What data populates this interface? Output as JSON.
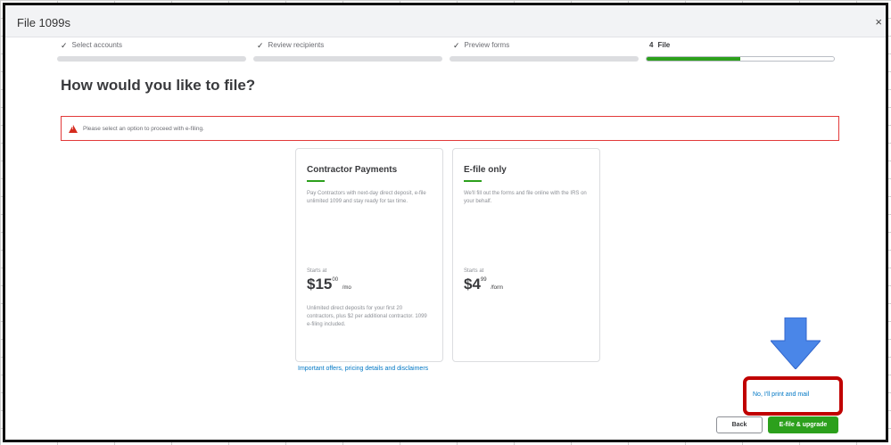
{
  "window": {
    "title": "File 1099s",
    "close_glyph": "×"
  },
  "stepper": {
    "steps": [
      {
        "label": "Select accounts",
        "prefix": "✓",
        "progress": 0
      },
      {
        "label": "Review recipients",
        "prefix": "✓",
        "progress": 0
      },
      {
        "label": "Preview forms",
        "prefix": "✓",
        "progress": 0
      },
      {
        "label": "File",
        "prefix": "4",
        "progress": 0.5
      }
    ]
  },
  "page": {
    "title": "How would you like to file?"
  },
  "alert": {
    "text": "Please select an option to proceed with e-filing."
  },
  "cards": [
    {
      "title": "Contractor Payments",
      "description": "Pay Contractors with next-day direct deposit, e-file unlimited 1099 and stay ready for tax time.",
      "starts_at": "Starts at",
      "price_main": "$15",
      "price_cents": "00",
      "price_unit": "/mo",
      "footnote": "Unlimited direct deposits for your first 20 contractors, plus $2 per additional contractor. 1099 e-filing included."
    },
    {
      "title": "E-file only",
      "description": "We'll fill out the forms and file online with the IRS on your behalf.",
      "starts_at": "Starts at",
      "price_main": "$4",
      "price_cents": "99",
      "price_unit": "/form",
      "footnote": ""
    }
  ],
  "links": {
    "offers": "Important offers, pricing details and disclaimers",
    "print_mail": "No, I'll print and mail"
  },
  "buttons": {
    "back": "Back",
    "primary": "E-file & upgrade"
  },
  "colors": {
    "accent_green": "#2ca01c",
    "link_blue": "#0077c5",
    "alert_red": "#e23a3a",
    "highlight_red": "#c00000",
    "arrow_blue": "#4a86e8"
  }
}
